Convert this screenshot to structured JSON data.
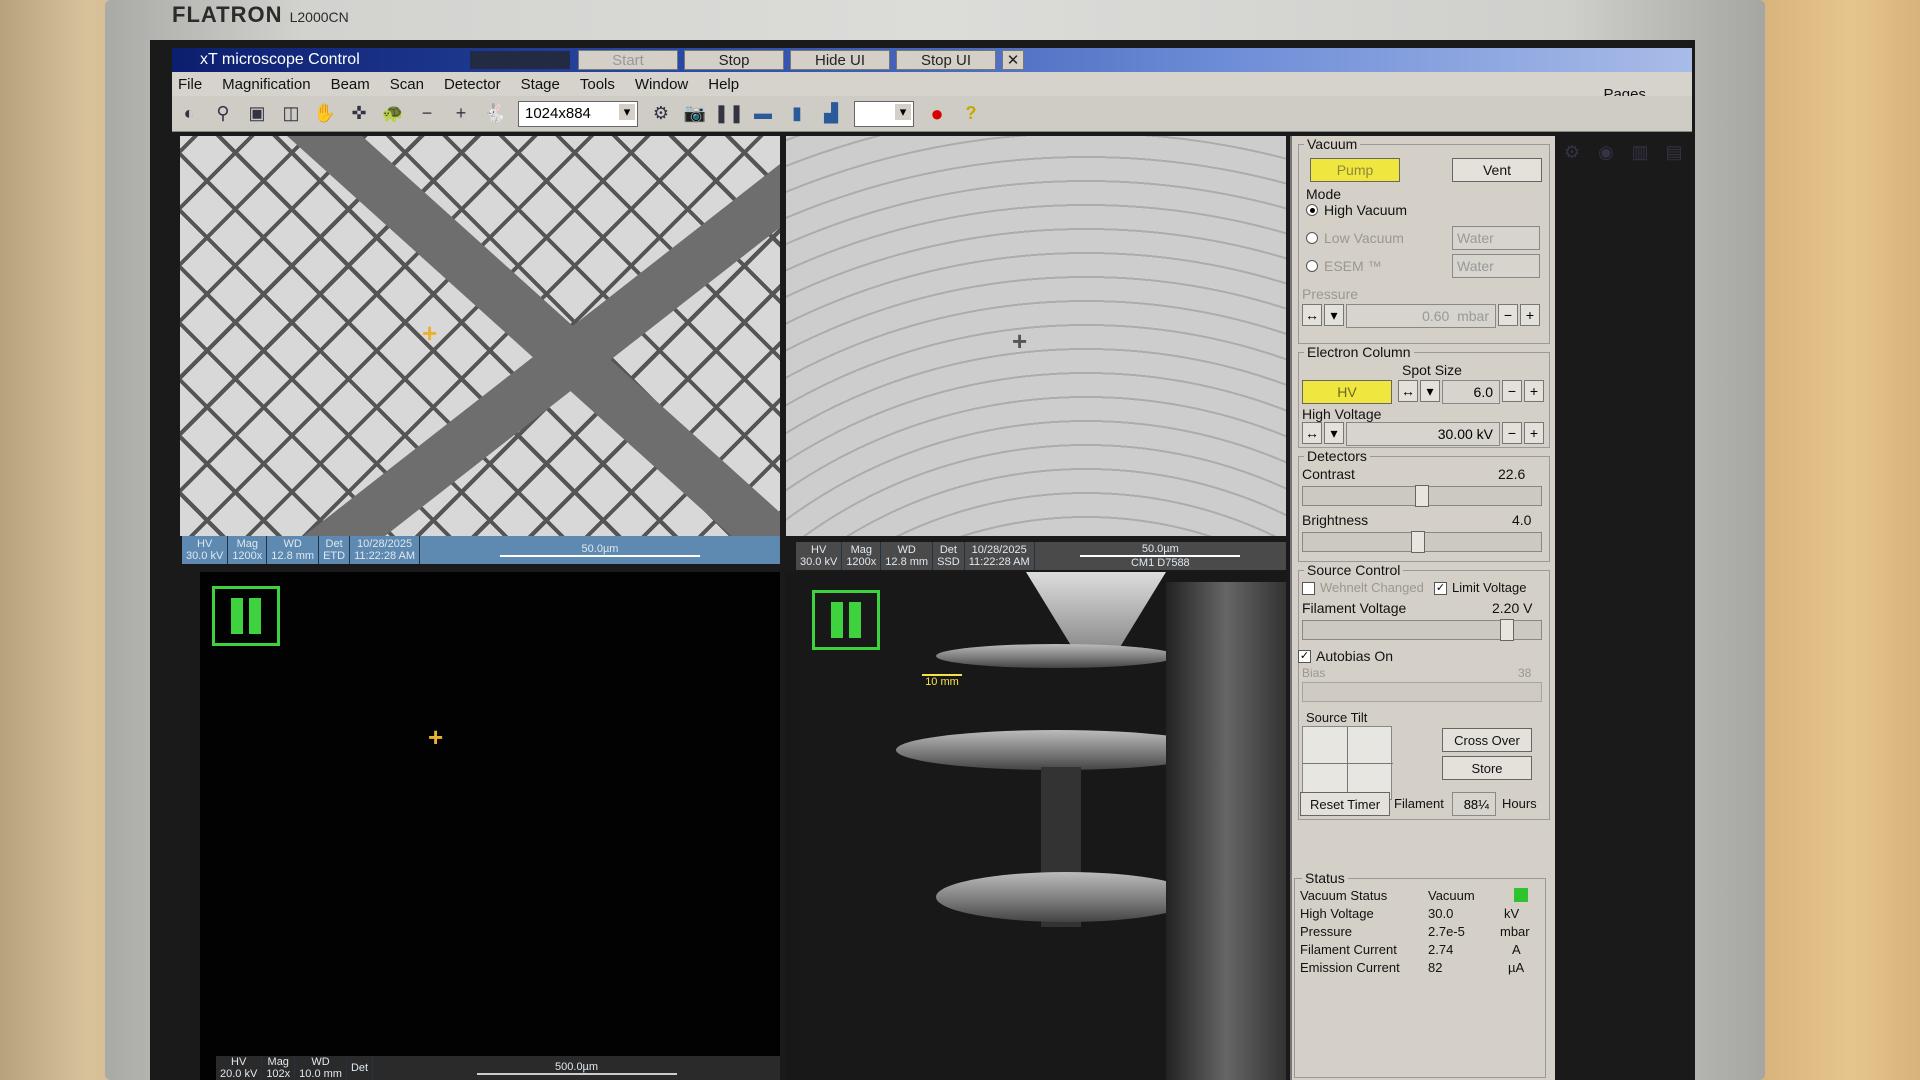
{
  "monitor": {
    "brand": "FLATRON",
    "model": "L2000CN"
  },
  "window": {
    "title": "xT microscope Control",
    "title_buttons": [
      "Start",
      "Stop",
      "Hide UI",
      "Stop UI"
    ],
    "close_glyph": "✕",
    "menu": [
      "File",
      "Magnification",
      "Beam",
      "Scan",
      "Detector",
      "Stage",
      "Tools",
      "Window",
      "Help"
    ],
    "pages_label": "Pages"
  },
  "toolbar": {
    "resolution": "1024x884",
    "help_glyph": "?"
  },
  "quads": {
    "q1": {
      "info": [
        {
          "k": "HV",
          "v": "30.0 kV"
        },
        {
          "k": "Mag",
          "v": "1200x"
        },
        {
          "k": "WD",
          "v": "12.8 mm"
        },
        {
          "k": "Det",
          "v": "ETD"
        },
        {
          "k": "10/28/2025",
          "v": "11:22:28 AM"
        }
      ],
      "scale": "50.0µm"
    },
    "q2": {
      "info": [
        {
          "k": "HV",
          "v": "30.0 kV"
        },
        {
          "k": "Mag",
          "v": "1200x"
        },
        {
          "k": "WD",
          "v": "12.8 mm"
        },
        {
          "k": "Det",
          "v": "SSD"
        },
        {
          "k": "10/28/2025",
          "v": "11:22:28 AM"
        }
      ],
      "scale": "50.0µm",
      "sample_id": "CM1 D7588"
    },
    "q3": {
      "info": [
        {
          "k": "HV",
          "v": "20.0 kV"
        },
        {
          "k": "Mag",
          "v": "102x"
        },
        {
          "k": "WD",
          "v": "10.0 mm"
        },
        {
          "k": "Det",
          "v": ""
        }
      ],
      "scale": "500.0µm"
    },
    "q4": {
      "scale": "10 mm"
    }
  },
  "panel": {
    "vacuum": {
      "title": "Vacuum",
      "pump": "Pump",
      "vent": "Vent"
    },
    "mode": {
      "title": "Mode",
      "high_vacuum": "High Vacuum",
      "low_vacuum": "Low Vacuum",
      "esem": "ESEM ™",
      "water1": "Water",
      "water2": "Water"
    },
    "pressure": {
      "title": "Pressure",
      "value": "0.60",
      "unit": "mbar"
    },
    "column": {
      "title": "Electron Column",
      "spot_size_label": "Spot Size",
      "hv_button": "HV",
      "spot_size": "6.0",
      "high_voltage_label": "High Voltage",
      "high_voltage": "30.00 kV"
    },
    "detectors": {
      "title": "Detectors",
      "contrast_label": "Contrast",
      "contrast": "22.6",
      "contrast_level": 0.5,
      "brightness_label": "Brightness",
      "brightness": "4.0",
      "brightness_level": 0.48
    },
    "source": {
      "title": "Source Control",
      "wehnelt": "Wehnelt Changed",
      "limit_voltage": "Limit Voltage",
      "filament_voltage_label": "Filament Voltage",
      "filament_voltage": "2.20 V",
      "filament_level": 0.88,
      "autobias": "Autobias On",
      "bias_label": "Bias",
      "bias": "38",
      "source_tilt": "Source Tilt",
      "cross_over": "Cross Over",
      "store": "Store",
      "reset_timer": "Reset Timer",
      "filament_label": "Filament",
      "filament_hours": "88¼",
      "hours_label": "Hours"
    },
    "status": {
      "title": "Status",
      "rows": [
        {
          "k": "Vacuum Status",
          "v": "Vacuum",
          "u": ""
        },
        {
          "k": "High Voltage",
          "v": "30.0",
          "u": "kV"
        },
        {
          "k": "Pressure",
          "v": "2.7e-5",
          "u": "mbar"
        },
        {
          "k": "Filament Current",
          "v": "2.74",
          "u": "A"
        },
        {
          "k": "Emission Current",
          "v": "82",
          "u": "µA"
        }
      ]
    },
    "colors": {
      "accent_yellow": "#f0e640",
      "status_green": "#2ec42e",
      "pause_green": "#3fd23f",
      "crosshair": "#e8b130"
    }
  }
}
